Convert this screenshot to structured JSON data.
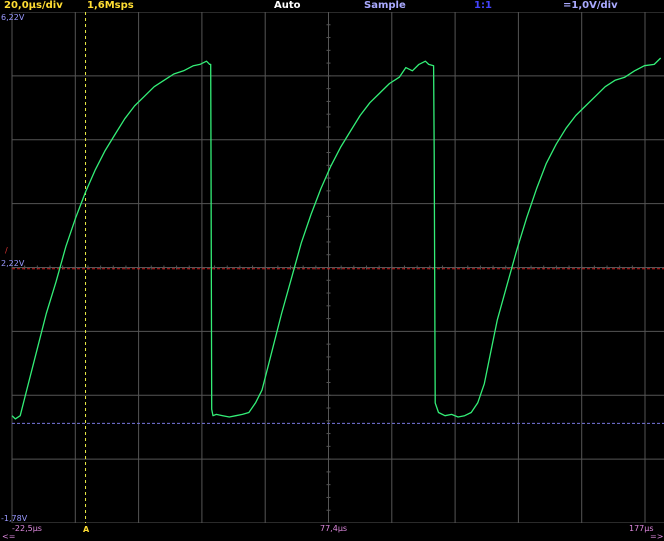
{
  "header": {
    "timebase": "20,0µs/div",
    "sample_rate": "1,6Msps",
    "trigger_mode": "Auto",
    "acq_mode": "Sample",
    "probe": "1:1",
    "volts_div": "=1,0V/div"
  },
  "scale": {
    "v_top": "6,22V",
    "v_mid": "2,22V",
    "v_bottom": "-1,78V",
    "trigger_marker": "/"
  },
  "footer": {
    "t_left": "-22,5µs",
    "t_mid": "77,4µs",
    "t_right": "177µs",
    "arrow_left": "<=",
    "arrow_right": "=>",
    "trigger_pos_marker": "A"
  },
  "colors": {
    "trace": "#33ee77",
    "grid": "#555555",
    "trigger_level": "#cc2222",
    "ground": "#7777dd",
    "cursor": "#eeee44",
    "header_yellow": "#ffdd33",
    "header_white": "#ffffff",
    "header_violet": "#aaaaff",
    "header_blue": "#4444ff",
    "label_violet": "#9999ff",
    "label_pink": "#dd88dd"
  },
  "chart_data": {
    "type": "line",
    "title": "",
    "xlabel": "",
    "ylabel": "",
    "xlim": [
      -22.5,
      177
    ],
    "ylim": [
      -1.78,
      6.22
    ],
    "grid": true,
    "series": [
      {
        "x": [
          -22.5,
          -21.5,
          -20,
          -18,
          -15,
          -12,
          -9,
          -6,
          -3,
          0,
          3,
          6,
          9,
          12,
          15,
          18,
          21,
          24,
          27,
          30,
          33,
          35,
          37,
          38,
          38.3,
          38.4,
          38.6,
          39,
          40,
          42,
          44,
          46,
          48,
          50,
          52,
          54,
          57,
          60,
          63,
          66,
          69,
          72,
          75,
          78,
          81,
          84,
          87,
          90,
          93,
          96,
          98,
          100,
          102,
          104,
          105,
          106.5,
          106.7,
          107,
          108,
          110,
          112,
          114,
          116,
          118,
          120,
          122,
          124,
          126,
          129,
          132,
          135,
          138,
          141,
          144,
          147,
          150,
          153,
          156,
          159,
          162,
          165,
          168,
          171,
          174,
          176
        ],
        "y": [
          -0.1,
          -0.15,
          -0.1,
          0.3,
          0.9,
          1.5,
          2.0,
          2.55,
          3.0,
          3.4,
          3.75,
          4.05,
          4.3,
          4.55,
          4.75,
          4.9,
          5.05,
          5.15,
          5.25,
          5.3,
          5.38,
          5.4,
          5.45,
          5.4,
          5.4,
          4.0,
          0.0,
          -0.1,
          -0.08,
          -0.1,
          -0.12,
          -0.1,
          -0.08,
          -0.05,
          0.1,
          0.3,
          0.9,
          1.5,
          2.05,
          2.6,
          3.05,
          3.45,
          3.8,
          4.1,
          4.35,
          4.6,
          4.8,
          4.95,
          5.1,
          5.2,
          5.35,
          5.3,
          5.4,
          5.45,
          5.4,
          5.38,
          4.0,
          0.1,
          -0.05,
          -0.1,
          -0.08,
          -0.12,
          -0.1,
          -0.05,
          0.1,
          0.4,
          0.9,
          1.4,
          1.95,
          2.5,
          3.0,
          3.45,
          3.85,
          4.15,
          4.4,
          4.6,
          4.75,
          4.9,
          5.05,
          5.15,
          5.2,
          5.3,
          5.38,
          5.4,
          5.5
        ]
      }
    ]
  }
}
